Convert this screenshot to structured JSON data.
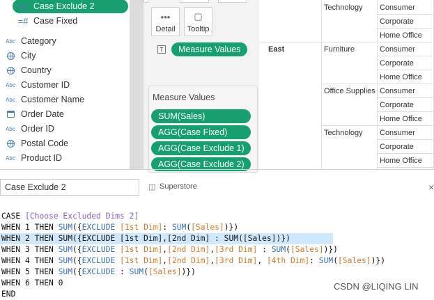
{
  "data_pane": {
    "fields": [
      {
        "label": "Case Exclude 2",
        "icon": "calc-icon",
        "glyph": "=#",
        "selected": true
      },
      {
        "label": "Case Fixed",
        "icon": "calc-icon",
        "glyph": "=#",
        "selected": false
      },
      {
        "label": "Category",
        "icon": "abc-icon",
        "glyph": "Abc"
      },
      {
        "label": "City",
        "icon": "globe-icon"
      },
      {
        "label": "Country",
        "icon": "globe-icon"
      },
      {
        "label": "Customer ID",
        "icon": "abc-icon",
        "glyph": "Abc"
      },
      {
        "label": "Customer Name",
        "icon": "abc-icon",
        "glyph": "Abc"
      },
      {
        "label": "Order Date",
        "icon": "calendar-icon"
      },
      {
        "label": "Order ID",
        "icon": "abc-icon",
        "glyph": "Abc"
      },
      {
        "label": "Postal Code",
        "icon": "globe-icon"
      },
      {
        "label": "Product ID",
        "icon": "abc-icon",
        "glyph": "Abc"
      }
    ]
  },
  "marks": {
    "detail_label": "Detail",
    "tooltip_label": "Tooltip",
    "text_glyph": "T",
    "measure_values_pill": "Measure Values"
  },
  "measure_values_card": {
    "title": "Measure Values",
    "pills": [
      "SUM(Sales)",
      "AGG(Case Fixed)",
      "AGG(Case Exclude 1)",
      "AGG(Case Exclude 2)"
    ]
  },
  "view": {
    "region": "East",
    "rows": [
      {
        "category": "Technology",
        "segment": "Consumer"
      },
      {
        "category": "",
        "segment": "Corporate"
      },
      {
        "category": "",
        "segment": "Home Office"
      },
      {
        "category": "Furniture",
        "segment": "Consumer"
      },
      {
        "category": "",
        "segment": "Corporate"
      },
      {
        "category": "",
        "segment": "Home Office"
      },
      {
        "category": "Office Supplies",
        "segment": "Consumer"
      },
      {
        "category": "",
        "segment": "Corporate"
      },
      {
        "category": "",
        "segment": "Home Office"
      },
      {
        "category": "Technology",
        "segment": "Consumer"
      },
      {
        "category": "",
        "segment": "Corporate"
      },
      {
        "category": "",
        "segment": "Home Office"
      }
    ]
  },
  "editor": {
    "calc_name": "Case Exclude 2",
    "data_source": "Superstore",
    "close_glyph": "×",
    "code_lines": [
      [
        {
          "t": "CASE ",
          "c": "kw"
        },
        {
          "t": "[Choose Excluded Dims 2]",
          "c": "cm"
        }
      ],
      [
        {
          "t": "WHEN 1 THEN ",
          "c": "kw"
        },
        {
          "t": "SUM",
          "c": "fn"
        },
        {
          "t": "({",
          "c": "pn"
        },
        {
          "t": "EXCLUDE ",
          "c": "fn"
        },
        {
          "t": "[1st Dim]",
          "c": "prm"
        },
        {
          "t": ": ",
          "c": "pn"
        },
        {
          "t": "SUM",
          "c": "fn"
        },
        {
          "t": "(",
          "c": "pn"
        },
        {
          "t": "[Sales]",
          "c": "prm"
        },
        {
          "t": ")})",
          "c": "pn"
        }
      ],
      [
        {
          "t": "WHEN 2 THEN SUM({EXCLUDE [1st Dim],[2nd Dim] : SUM([Sales])})",
          "c": "kw"
        }
      ],
      [
        {
          "t": "WHEN 3 THEN ",
          "c": "kw"
        },
        {
          "t": "SUM",
          "c": "fn"
        },
        {
          "t": "({",
          "c": "pn"
        },
        {
          "t": "EXCLUDE ",
          "c": "fn"
        },
        {
          "t": "[1st Dim]",
          "c": "prm"
        },
        {
          "t": ",",
          "c": "pn"
        },
        {
          "t": "[2nd Dim]",
          "c": "prm"
        },
        {
          "t": ",",
          "c": "pn"
        },
        {
          "t": "[3rd Dim]",
          "c": "prm"
        },
        {
          "t": " : ",
          "c": "pn"
        },
        {
          "t": "SUM",
          "c": "fn"
        },
        {
          "t": "(",
          "c": "pn"
        },
        {
          "t": "[Sales]",
          "c": "prm"
        },
        {
          "t": ")})",
          "c": "pn"
        }
      ],
      [
        {
          "t": "WHEN 4 THEN ",
          "c": "kw"
        },
        {
          "t": "SUM",
          "c": "fn"
        },
        {
          "t": "({",
          "c": "pn"
        },
        {
          "t": "EXCLUDE ",
          "c": "fn"
        },
        {
          "t": "[1st Dim]",
          "c": "prm"
        },
        {
          "t": ",",
          "c": "pn"
        },
        {
          "t": "[2nd Dim]",
          "c": "prm"
        },
        {
          "t": ",",
          "c": "pn"
        },
        {
          "t": "[3rd Dim]",
          "c": "prm"
        },
        {
          "t": ", ",
          "c": "pn"
        },
        {
          "t": "[4th Dim]",
          "c": "prm"
        },
        {
          "t": ": ",
          "c": "pn"
        },
        {
          "t": "SUM",
          "c": "fn"
        },
        {
          "t": "(",
          "c": "pn"
        },
        {
          "t": "[Sales]",
          "c": "prm"
        },
        {
          "t": ")})",
          "c": "pn"
        }
      ],
      [
        {
          "t": "WHEN 5 THEN ",
          "c": "kw"
        },
        {
          "t": "SUM",
          "c": "fn"
        },
        {
          "t": "({",
          "c": "pn"
        },
        {
          "t": "EXCLUDE ",
          "c": "fn"
        },
        {
          "t": ": ",
          "c": "pn"
        },
        {
          "t": "SUM",
          "c": "fn"
        },
        {
          "t": "(",
          "c": "pn"
        },
        {
          "t": "[Sales]",
          "c": "prm"
        },
        {
          "t": ")})",
          "c": "pn"
        }
      ],
      [
        {
          "t": "WHEN 6 THEN 0",
          "c": "kw"
        }
      ],
      [
        {
          "t": "END",
          "c": "kw"
        }
      ]
    ],
    "highlighted_line": 2
  },
  "watermark": "CSDN @LIQING LIN",
  "colors": {
    "accent_green": "#17a06f",
    "highlight": "#cfe8fc",
    "function_blue": "#3a6fb0",
    "param_orange": "#d27a2b",
    "comment_purple": "#8b5fbf"
  }
}
